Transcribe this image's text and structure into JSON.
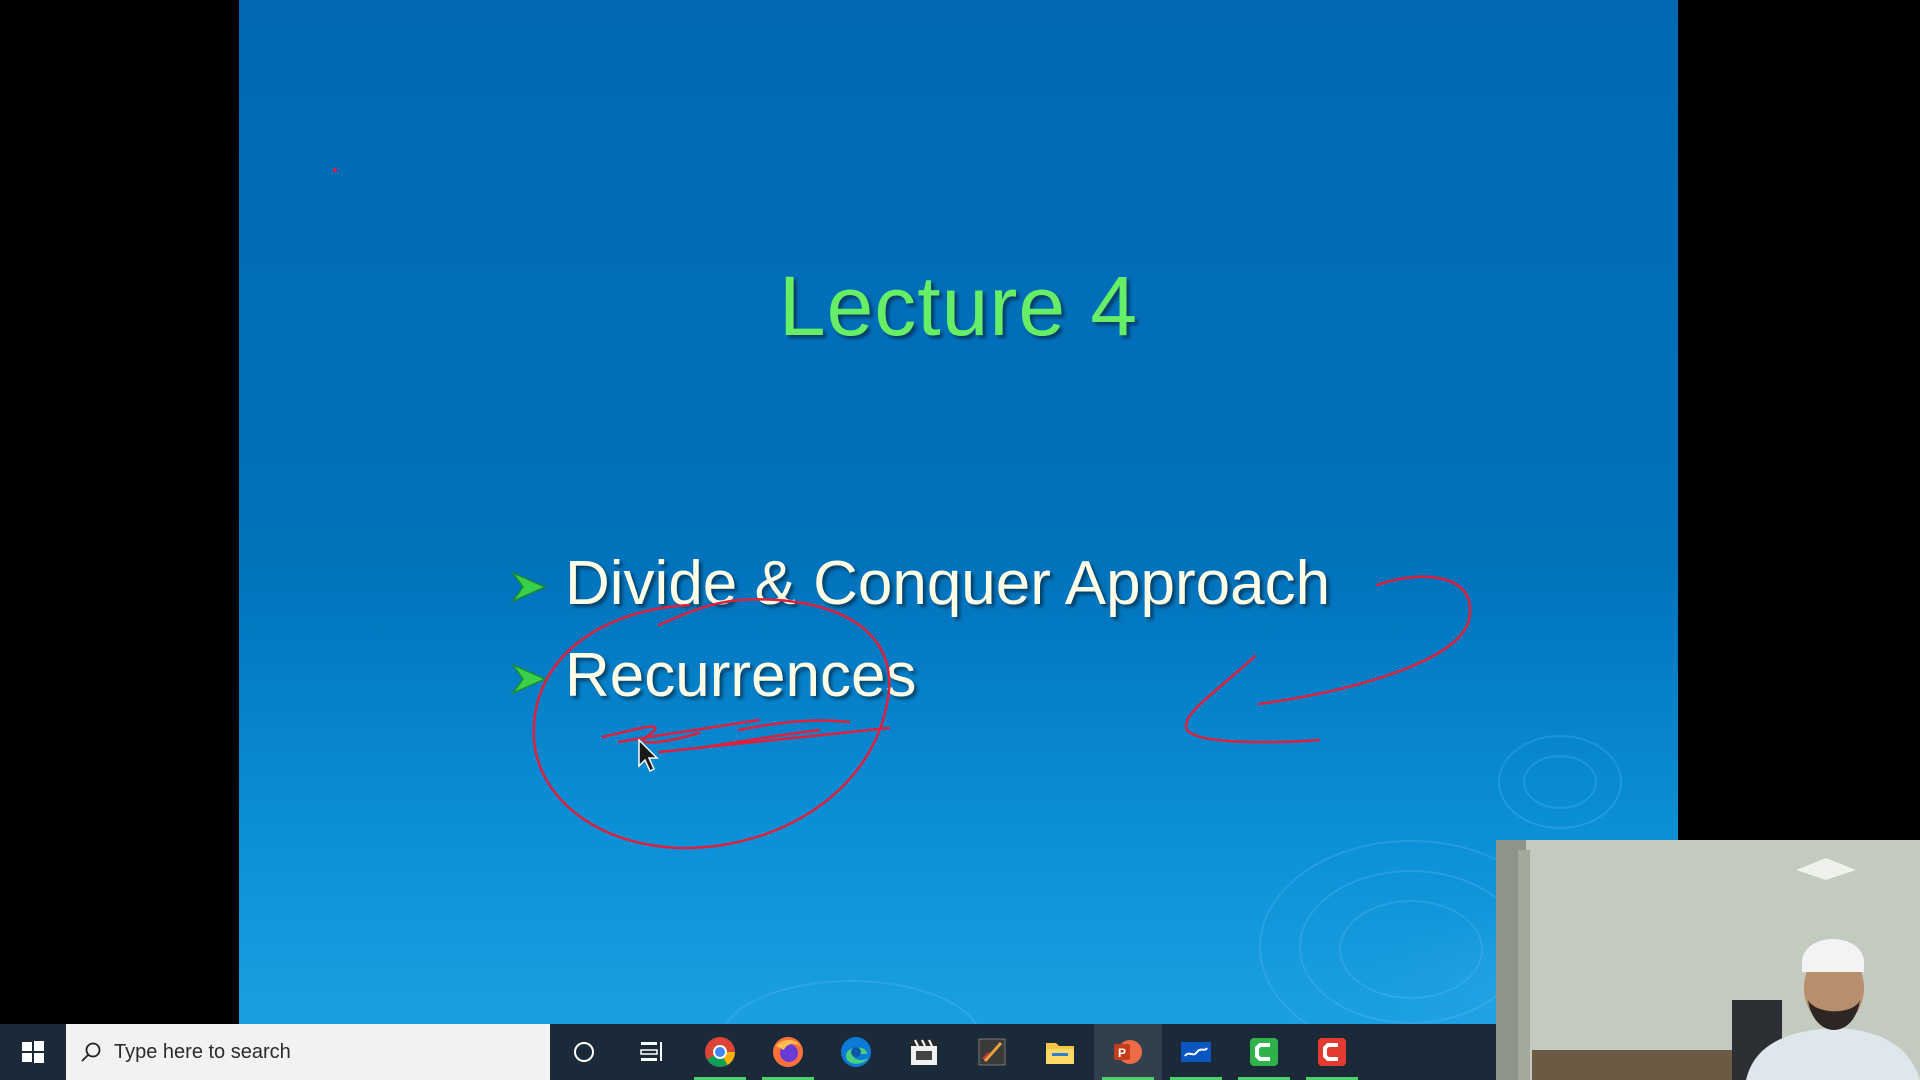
{
  "slide": {
    "title": "Lecture 4",
    "bullets": [
      {
        "text": "Divide & Conquer Approach"
      },
      {
        "text": "Recurrences"
      }
    ],
    "colors": {
      "background": "#0171bb",
      "title": "#66ee66",
      "bullet_text": "#fffde6",
      "bullet_arrow": "#3ad14a",
      "annotation_ink": "#e0203a"
    }
  },
  "taskbar": {
    "search_placeholder": "Type here to search",
    "pinned": [
      {
        "name": "cortana",
        "icon": "circle-icon",
        "running": false
      },
      {
        "name": "task-view",
        "icon": "task-view-icon",
        "running": false
      },
      {
        "name": "chrome",
        "icon": "chrome-icon",
        "running": true
      },
      {
        "name": "firefox",
        "icon": "firefox-icon",
        "running": true
      },
      {
        "name": "edge",
        "icon": "edge-icon",
        "running": false
      },
      {
        "name": "calendar-countdown",
        "icon": "clapper-calendar-icon",
        "running": false
      },
      {
        "name": "pen-tool",
        "icon": "pen-tablet-icon",
        "running": false
      },
      {
        "name": "file-explorer",
        "icon": "folder-icon",
        "running": false
      },
      {
        "name": "powerpoint",
        "icon": "powerpoint-icon",
        "running": true
      },
      {
        "name": "screen-sketch",
        "icon": "whiteboard-icon",
        "running": true
      },
      {
        "name": "camtasia",
        "icon": "camtasia-green-icon",
        "running": true
      },
      {
        "name": "camtasia-recorder",
        "icon": "camtasia-red-icon",
        "running": true
      }
    ],
    "colors": {
      "background": "#1b2a38",
      "running_indicator": "#4fd16a"
    }
  },
  "webcam": {
    "icon": "presenter-video-icon"
  }
}
